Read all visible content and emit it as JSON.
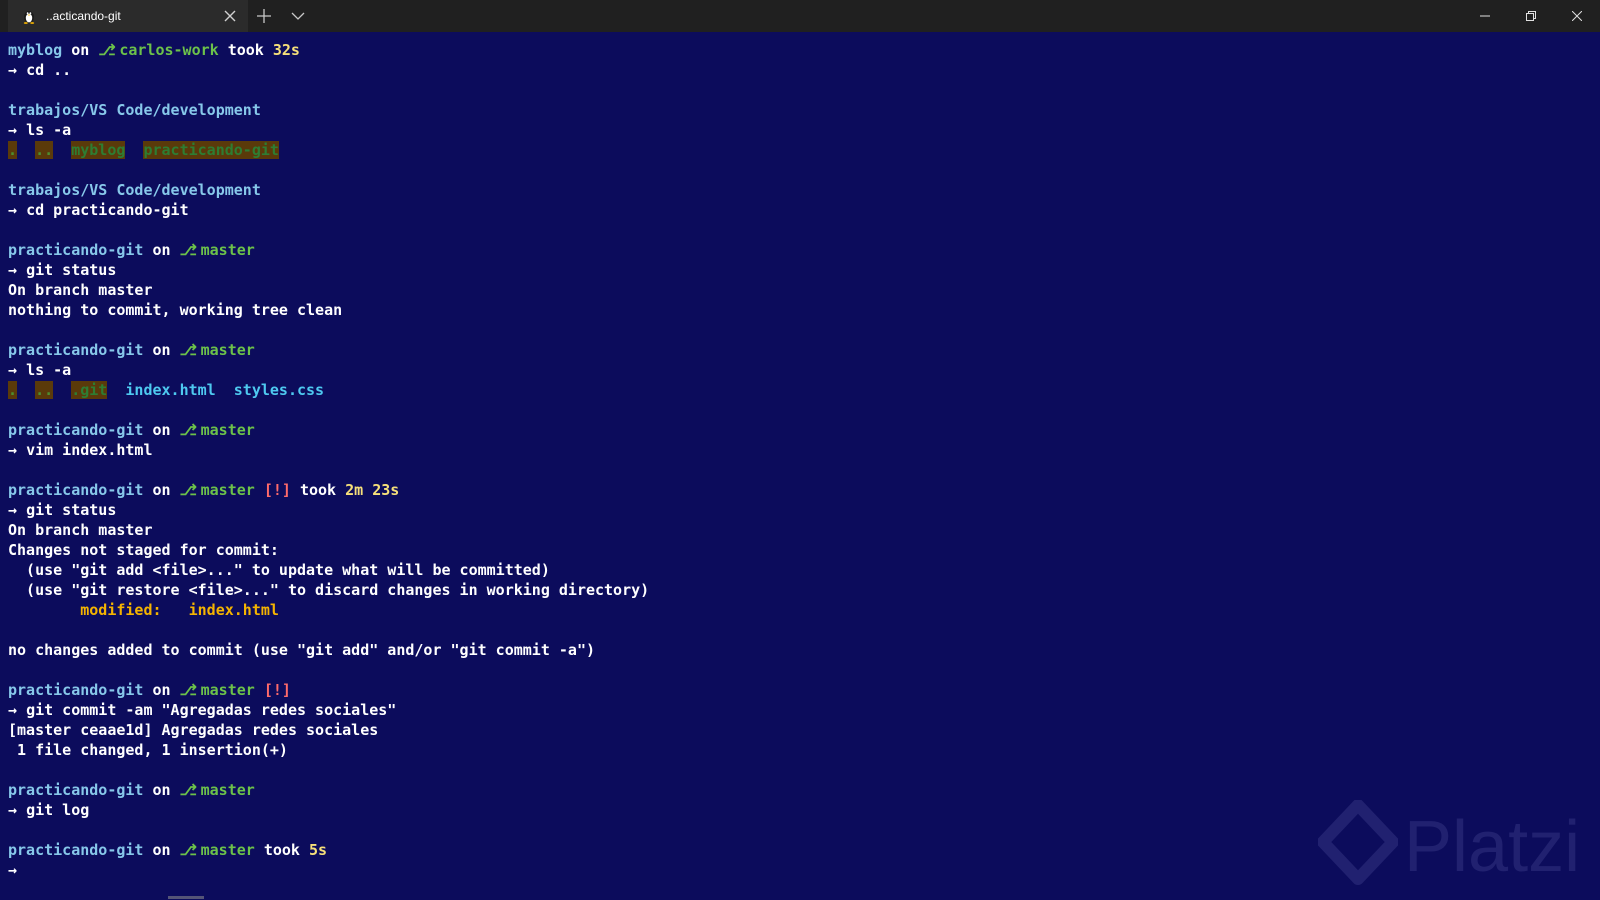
{
  "window": {
    "tab_title": "..acticando-git",
    "tab_icon": "linux-penguin-icon",
    "new_tab": "plus-icon",
    "dropdown": "chevron-down-icon"
  },
  "colors": {
    "background": "#0c0c5c",
    "directory": "#87c8ea",
    "branch": "#6cc24a",
    "modified": "#f5b400",
    "status_flag": "#ff6b6b"
  },
  "lines": [
    {
      "type": "prompt",
      "dir": "myblog",
      "on": " on ",
      "branch": "carlos-work",
      "flag": "",
      "took": " took ",
      "time": "32s"
    },
    {
      "type": "cmd",
      "text": "cd .."
    },
    {
      "type": "blank"
    },
    {
      "type": "prompt_dir",
      "dir": "trabajos/VS Code/development"
    },
    {
      "type": "cmd",
      "text": "ls -a"
    },
    {
      "type": "ls1",
      "items": [
        ".",
        "..",
        "myblog",
        "practicando-git"
      ]
    },
    {
      "type": "blank"
    },
    {
      "type": "prompt_dir",
      "dir": "trabajos/VS Code/development"
    },
    {
      "type": "cmd",
      "text": "cd practicando-git"
    },
    {
      "type": "blank"
    },
    {
      "type": "prompt",
      "dir": "practicando-git",
      "on": " on ",
      "branch": "master",
      "flag": "",
      "took": "",
      "time": ""
    },
    {
      "type": "cmd",
      "text": "git status"
    },
    {
      "type": "out",
      "text": "On branch master"
    },
    {
      "type": "out",
      "text": "nothing to commit, working tree clean"
    },
    {
      "type": "blank"
    },
    {
      "type": "prompt",
      "dir": "practicando-git",
      "on": " on ",
      "branch": "master",
      "flag": "",
      "took": "",
      "time": ""
    },
    {
      "type": "cmd",
      "text": "ls -a"
    },
    {
      "type": "ls2",
      "items": [
        ".",
        "..",
        ".git",
        "index.html",
        "styles.css"
      ]
    },
    {
      "type": "blank"
    },
    {
      "type": "prompt",
      "dir": "practicando-git",
      "on": " on ",
      "branch": "master",
      "flag": "",
      "took": "",
      "time": ""
    },
    {
      "type": "cmd",
      "text": "vim index.html"
    },
    {
      "type": "blank"
    },
    {
      "type": "prompt",
      "dir": "practicando-git",
      "on": " on ",
      "branch": "master",
      "flag": " [!]",
      "took": " took ",
      "time": "2m 23s"
    },
    {
      "type": "cmd",
      "text": "git status"
    },
    {
      "type": "out",
      "text": "On branch master"
    },
    {
      "type": "out",
      "text": "Changes not staged for commit:"
    },
    {
      "type": "out",
      "text": "  (use \"git add <file>...\" to update what will be committed)"
    },
    {
      "type": "out",
      "text": "  (use \"git restore <file>...\" to discard changes in working directory)"
    },
    {
      "type": "modified",
      "label": "        modified:   ",
      "file": "index.html"
    },
    {
      "type": "blank"
    },
    {
      "type": "out",
      "text": "no changes added to commit (use \"git add\" and/or \"git commit -a\")"
    },
    {
      "type": "blank"
    },
    {
      "type": "prompt",
      "dir": "practicando-git",
      "on": " on ",
      "branch": "master",
      "flag": " [!]",
      "took": "",
      "time": ""
    },
    {
      "type": "cmd",
      "text": "git commit -am \"Agregadas redes sociales\""
    },
    {
      "type": "out",
      "text": "[master ceaae1d] Agregadas redes sociales"
    },
    {
      "type": "out",
      "text": " 1 file changed, 1 insertion(+)"
    },
    {
      "type": "blank"
    },
    {
      "type": "prompt",
      "dir": "practicando-git",
      "on": " on ",
      "branch": "master",
      "flag": "",
      "took": "",
      "time": ""
    },
    {
      "type": "cmd",
      "text": "git log"
    },
    {
      "type": "blank"
    },
    {
      "type": "prompt",
      "dir": "practicando-git",
      "on": " on ",
      "branch": "master",
      "flag": "",
      "took": " took ",
      "time": "5s"
    },
    {
      "type": "cmd",
      "text": ""
    }
  ],
  "prompt_arrow": "→ ",
  "watermark": "Platzi"
}
